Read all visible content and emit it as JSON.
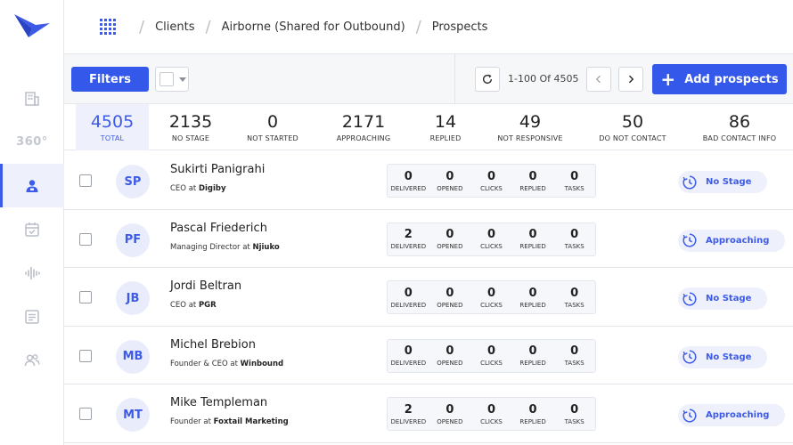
{
  "colors": {
    "accent": "#3358ea",
    "stat_active_bg": "#eef1fb"
  },
  "sidebar": {
    "items": [
      {
        "icon": "building-icon",
        "label": ""
      },
      {
        "icon": "360-icon",
        "label": "360°"
      },
      {
        "icon": "prospects-icon",
        "label": "",
        "active": true
      },
      {
        "icon": "calendar-check-icon",
        "label": ""
      },
      {
        "icon": "audio-wave-icon",
        "label": ""
      },
      {
        "icon": "document-icon",
        "label": ""
      },
      {
        "icon": "users-icon",
        "label": ""
      }
    ]
  },
  "breadcrumb": {
    "items": [
      "Clients",
      "Airborne (Shared for Outbound)",
      "Prospects"
    ]
  },
  "toolbar": {
    "filters_label": "Filters",
    "pager_text": "1-100 Of 4505",
    "add_label": "Add prospects"
  },
  "stats": [
    {
      "value": "4505",
      "label": "TOTAL"
    },
    {
      "value": "2135",
      "label": "NO STAGE"
    },
    {
      "value": "0",
      "label": "NOT STARTED"
    },
    {
      "value": "2171",
      "label": "APPROACHING"
    },
    {
      "value": "14",
      "label": "REPLIED"
    },
    {
      "value": "49",
      "label": "NOT RESPONSIVE"
    },
    {
      "value": "50",
      "label": "DO NOT CONTACT"
    },
    {
      "value": "86",
      "label": "BAD CONTACT INFO"
    }
  ],
  "metric_labels": [
    "DELIVERED",
    "OPENED",
    "CLICKS",
    "REPLIED",
    "TASKS"
  ],
  "prospects": [
    {
      "initials": "SP",
      "name": "Sukirti Panigrahi",
      "role": "CEO at",
      "company": "Digiby",
      "metrics": [
        "0",
        "0",
        "0",
        "0",
        "0"
      ],
      "stage": "No Stage"
    },
    {
      "initials": "PF",
      "name": "Pascal Friederich",
      "role": "Managing Director at",
      "company": "Njiuko",
      "metrics": [
        "2",
        "0",
        "0",
        "0",
        "0"
      ],
      "stage": "Approaching"
    },
    {
      "initials": "JB",
      "name": "Jordi Beltran",
      "role": "CEO at",
      "company": "PGR",
      "metrics": [
        "0",
        "0",
        "0",
        "0",
        "0"
      ],
      "stage": "No Stage"
    },
    {
      "initials": "MB",
      "name": "Michel Brebion",
      "role": "Founder & CEO at",
      "company": "Winbound",
      "metrics": [
        "0",
        "0",
        "0",
        "0",
        "0"
      ],
      "stage": "No Stage"
    },
    {
      "initials": "MT",
      "name": "Mike Templeman",
      "role": "Founder at",
      "company": "Foxtail Marketing",
      "metrics": [
        "2",
        "0",
        "0",
        "0",
        "0"
      ],
      "stage": "Approaching"
    }
  ]
}
